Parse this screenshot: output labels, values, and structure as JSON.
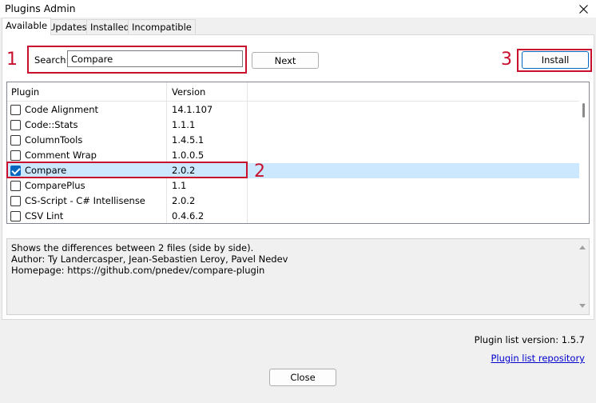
{
  "window": {
    "title": "Plugins Admin"
  },
  "tabs": [
    {
      "label": "Available",
      "active": true
    },
    {
      "label": "Updates"
    },
    {
      "label": "Installed"
    },
    {
      "label": "Incompatible"
    }
  ],
  "search": {
    "label": "Search:",
    "value": "Compare"
  },
  "buttons": {
    "next": "Next",
    "install": "Install",
    "close": "Close"
  },
  "annotations": {
    "one": "1",
    "two": "2",
    "three": "3"
  },
  "list": {
    "headers": {
      "plugin": "Plugin",
      "version": "Version"
    },
    "rows": [
      {
        "name": "Code Alignment",
        "version": "14.1.107",
        "checked": false
      },
      {
        "name": "Code::Stats",
        "version": "1.1.1",
        "checked": false
      },
      {
        "name": "ColumnTools",
        "version": "1.4.5.1",
        "checked": false
      },
      {
        "name": "Comment Wrap",
        "version": "1.0.0.5",
        "checked": false
      },
      {
        "name": "Compare",
        "version": "2.0.2",
        "checked": true,
        "selected": true
      },
      {
        "name": "ComparePlus",
        "version": "1.1",
        "checked": false
      },
      {
        "name": "CS-Script - C# Intellisense",
        "version": "2.0.2",
        "checked": false
      },
      {
        "name": "CSV Lint",
        "version": "0.4.6.2",
        "checked": false
      }
    ]
  },
  "description": {
    "lines": [
      "Shows the differences between 2 files (side by side).",
      "Author: Ty Landercasper, Jean-Sebastien Leroy, Pavel Nedev",
      "Homepage: https://github.com/pnedev/compare-plugin"
    ]
  },
  "footer": {
    "version_label": "Plugin list version:  1.5.7",
    "repo_link": "Plugin list repository"
  },
  "colors": {
    "annotation_red": "#c8102e",
    "selection": "#cce8ff",
    "accent": "#0067c0"
  }
}
